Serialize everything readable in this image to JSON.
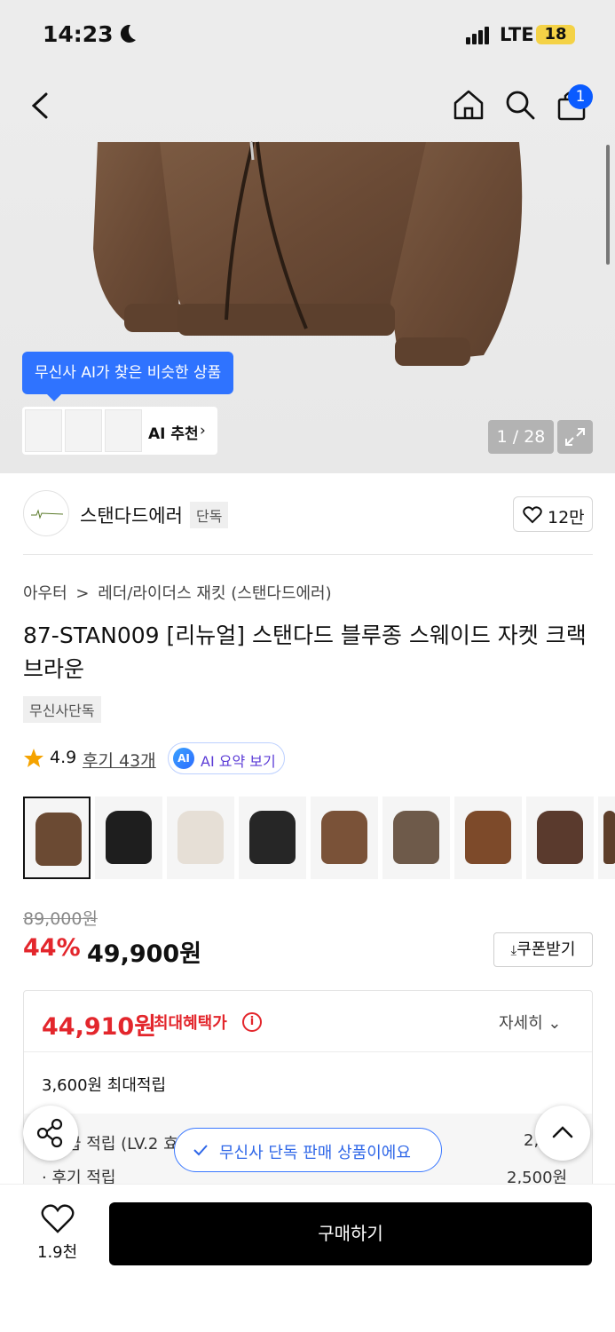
{
  "status_bar": {
    "time": "14:23",
    "network": "LTE",
    "battery": "18"
  },
  "header": {
    "cart_count": "1"
  },
  "gallery": {
    "ai_tooltip": "무신사 AI가 찾은 비슷한 상품",
    "ai_recommend_label": "AI 추천",
    "pager": "1 / 28"
  },
  "brand": {
    "name": "스탠다드에러",
    "tag": "단독",
    "likes": "12만"
  },
  "breadcrumb": {
    "category": "아우터",
    "sep": ">",
    "subcategory": "레더/라이더스 재킷 (스탠다드에러)"
  },
  "product": {
    "title": "87-STAN009 [리뉴얼] 스탠다드 블루종 스웨이드 자켓 크랙 브라운",
    "exclusive_tag": "무신사단독",
    "rating": "4.9",
    "reviews": "후기 43개",
    "ai_summary": "AI 요약 보기",
    "ai_badge": "AI"
  },
  "swatches": [
    {
      "name": "swatch-brown-selected",
      "color": "#6b4a33"
    },
    {
      "name": "swatch-black",
      "color": "#1e1e1e"
    },
    {
      "name": "swatch-ivory",
      "color": "#e6dfd6"
    },
    {
      "name": "swatch-black-leather",
      "color": "#262626"
    },
    {
      "name": "swatch-brown-2",
      "color": "#7a5238"
    },
    {
      "name": "swatch-taupe",
      "color": "#6e5a4a"
    },
    {
      "name": "swatch-rust",
      "color": "#7d4a2a"
    },
    {
      "name": "swatch-dark-brown",
      "color": "#5a3a2d"
    },
    {
      "name": "swatch-partial",
      "color": "#5e3f2a"
    }
  ],
  "price": {
    "original": "89,000원",
    "discount": "44%",
    "current": "49,900원",
    "coupon_button": "쿠폰받기"
  },
  "benefit": {
    "max_price": "44,910원",
    "max_label": "최대혜택가",
    "detail": "자세히",
    "points": "3,600원 최대적립",
    "row1_label": "· 등급 적립 (LV.2 효",
    "row1_value": "2,",
    "row2_label": "· 후기 적립",
    "row2_value": "2,500원"
  },
  "toast": "무신사 단독 판매 상품이에요",
  "bottom_bar": {
    "wish_count": "1.9천",
    "buy": "구매하기"
  },
  "colors": {
    "accent_red": "#e3262c",
    "accent_blue": "#2f73ff",
    "black": "#000000"
  }
}
